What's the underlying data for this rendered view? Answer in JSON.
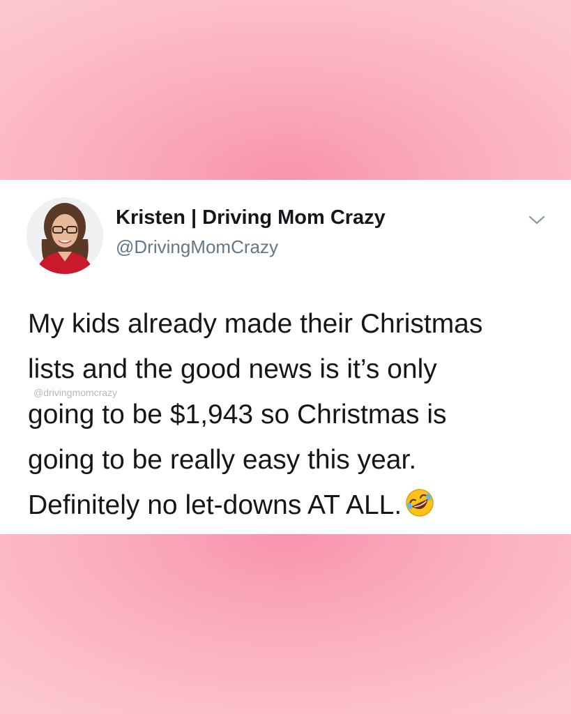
{
  "tweet": {
    "display_name": "Kristen | Driving Mom Crazy",
    "handle": "@DrivingMomCrazy",
    "lines": [
      "My kids already made their Christmas",
      "lists and the good news is it’s only",
      "going to be $1,943 so Christmas is",
      "going to be really easy this year.",
      "Definitely no let-downs AT ALL."
    ],
    "emoji": "rolling-on-floor-laughing-emoji",
    "watermark": "@drivingmomcrazy"
  },
  "colors": {
    "background_pink": "#f99bb3",
    "card": "#ffffff",
    "text": "#14171a",
    "secondary_text": "#657786"
  },
  "icons": {
    "menu": "chevron-down-icon"
  }
}
